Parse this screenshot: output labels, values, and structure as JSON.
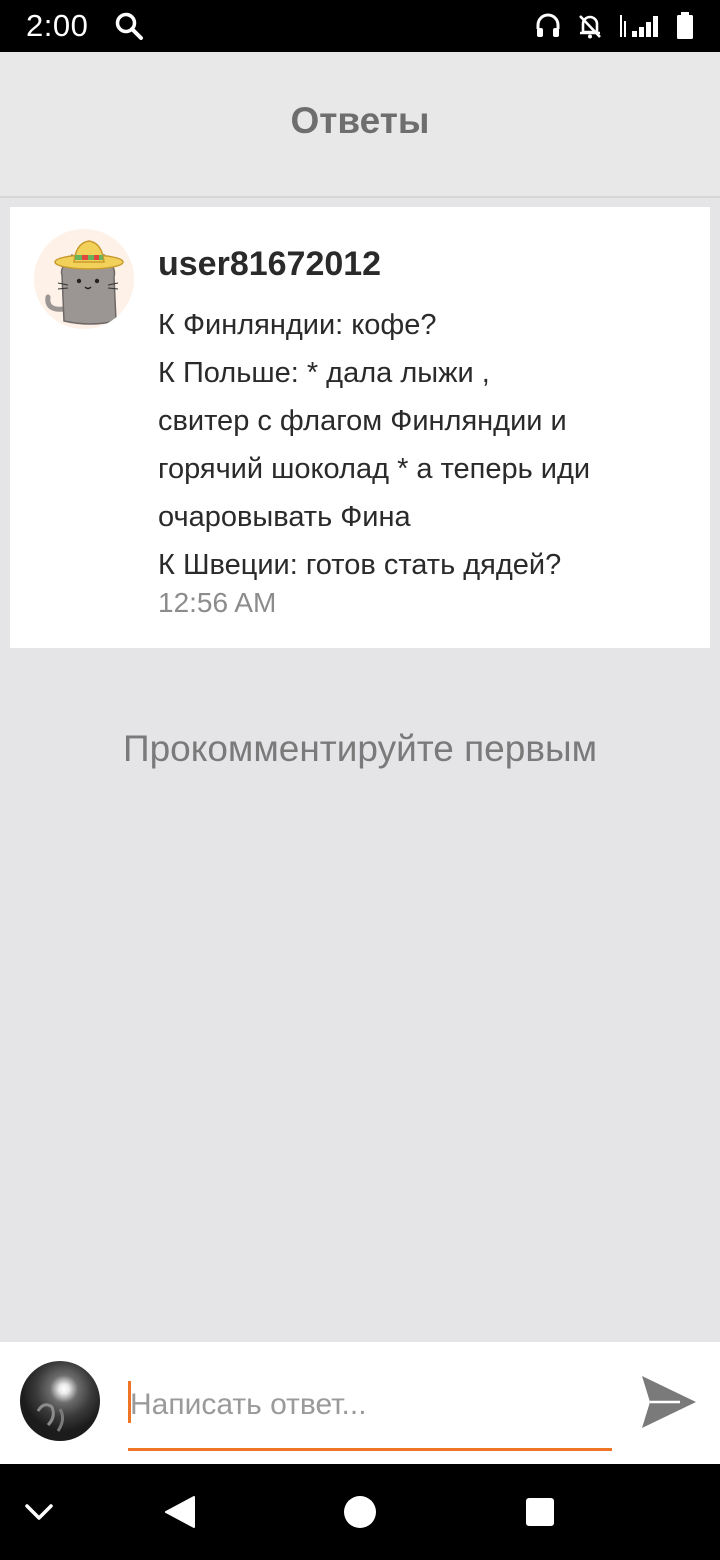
{
  "status_bar": {
    "time": "2:00",
    "icons": [
      "search-icon",
      "headset-icon",
      "notifications-off-icon",
      "signal-icon",
      "battery-icon"
    ]
  },
  "header": {
    "title": "Ответы"
  },
  "comment": {
    "author": "user81672012",
    "lines": [
      "К Финляндии: кофе?",
      "К Польше: * дала лыжи ,",
      "свитер с флагом Финляндии и",
      "горячий шоколад * а теперь иди",
      "очаровывать Фина",
      "К Швеции: готов стать дядей?"
    ],
    "time": "12:56 AM"
  },
  "empty_state": "Прокомментируйте первым",
  "reply": {
    "placeholder": "Написать ответ...",
    "value": ""
  },
  "colors": {
    "accent": "#ee7426",
    "background": "#e5e4e7",
    "header": "#e8e8e8"
  },
  "nav": [
    "chevron-down-icon",
    "back-icon",
    "home-icon",
    "recents-icon"
  ]
}
